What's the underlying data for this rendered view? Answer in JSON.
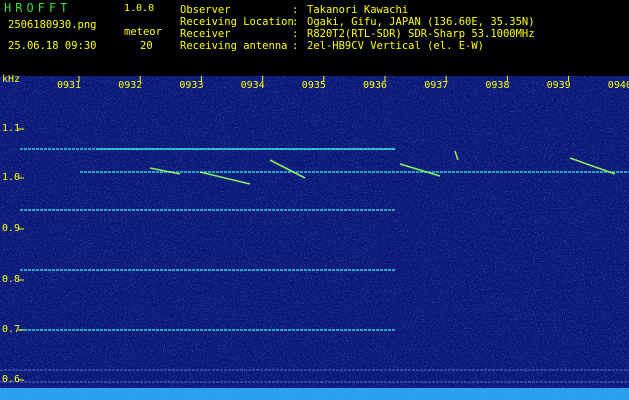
{
  "app": {
    "title": "HROFFT",
    "version": "1.0.0"
  },
  "file_name": "2506180930.png",
  "datetime": "25.06.18 09:30",
  "meteor": {
    "label": "meteor",
    "count": "20"
  },
  "info": [
    {
      "label": "Observer",
      "value": "Takanori Kawachi"
    },
    {
      "label": "Receiving Location",
      "value": "Ogaki, Gifu, JAPAN (136.60E, 35.35N)"
    },
    {
      "label": "Receiver",
      "value": "R820T2(RTL-SDR) SDR-Sharp 53.1000MHz"
    },
    {
      "label": "Receiving antenna",
      "value": "2el-HB9CV Vertical (el. E-W)"
    }
  ],
  "spectrogram": {
    "y_unit": "kHz",
    "y_ticks": [
      "1.1",
      "1.0",
      "0.9",
      "0.8",
      "0.7",
      "0.6"
    ],
    "x_ticks": [
      "0931",
      "0932",
      "0933",
      "0934",
      "0935",
      "0936",
      "0937",
      "0938",
      "0939",
      "0940"
    ],
    "colors": {
      "background": "#0a1878",
      "label": "#ffff00",
      "trace": "#2fe8e0",
      "signal": "#9cff5a"
    }
  }
}
